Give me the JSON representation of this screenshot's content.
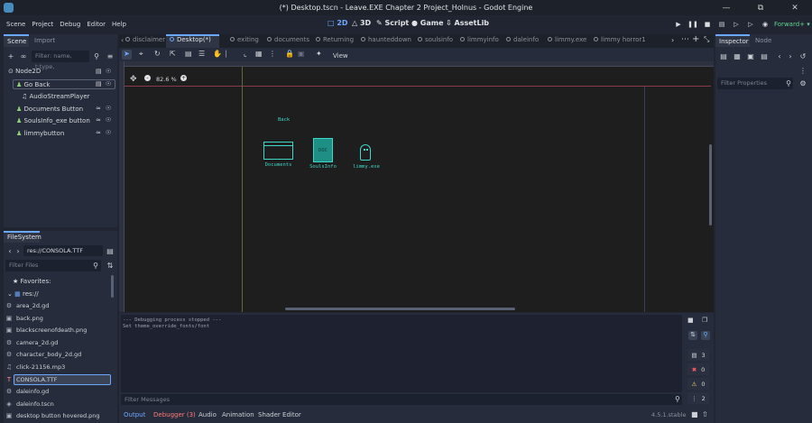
{
  "window": {
    "title": "(*) Desktop.tscn - Leave.EXE Chapter 2 Project_Holnus - Godot Engine"
  },
  "menu": [
    "Scene",
    "Project",
    "Debug",
    "Editor",
    "Help"
  ],
  "workspaces": [
    "2D",
    "3D",
    "Script",
    "Game",
    "AssetLib"
  ],
  "renderer": "Forward+",
  "scene_dock": {
    "tabs": [
      "Scene",
      "Import"
    ],
    "filter_placeholder": "Filter: name, t:type,",
    "nodes": [
      {
        "name": "Node2D"
      },
      {
        "name": "Go Back"
      },
      {
        "name": "AudioStreamPlayer"
      },
      {
        "name": "Documents Button"
      },
      {
        "name": "SoulsInfo_exe button"
      },
      {
        "name": "limmybutton"
      }
    ]
  },
  "filesystem": {
    "tab": "FileSystem",
    "path": "res://CONSOLA.TTF",
    "filter_placeholder": "Filter Files",
    "favorites": "Favorites:",
    "root": "res://",
    "files": [
      {
        "name": "area_2d.gd",
        "icon": "gear-icon"
      },
      {
        "name": "back.png",
        "icon": "image-icon"
      },
      {
        "name": "blackscreenofdeath.png",
        "icon": "image-icon"
      },
      {
        "name": "camera_2d.gd",
        "icon": "gear-icon"
      },
      {
        "name": "character_body_2d.gd",
        "icon": "gear-icon"
      },
      {
        "name": "click-21156.mp3",
        "icon": "audio-icon"
      },
      {
        "name": "CONSOLA.TTF",
        "icon": "font-icon"
      },
      {
        "name": "daleinfo.gd",
        "icon": "gear-icon"
      },
      {
        "name": "daleinfo.tscn",
        "icon": "scene-icon"
      },
      {
        "name": "desktop button hovered.png",
        "icon": "image-icon"
      }
    ]
  },
  "editor_tabs": [
    "disclaimer",
    "Desktop(*)",
    "exiting",
    "documents",
    "Returning",
    "haunteddown",
    "soulsinfo",
    "limmyinfo",
    "daleinfo",
    "limmy.exe",
    "limmy horror1"
  ],
  "viewport": {
    "zoom": "82.6 %",
    "view_label": "View",
    "items": {
      "back": "Back",
      "documents": "Documents",
      "soulsinfo": "SoulsInfo",
      "limmy": "limmy.exe",
      "folder_text": "DOC"
    }
  },
  "output": {
    "lines": [
      "--- Debugging process stopped ---",
      "Set theme_override_fonts/font"
    ],
    "filter_placeholder": "Filter Messages",
    "counts": {
      "messages": "3",
      "errors": "0",
      "warnings": "0",
      "info": "2"
    }
  },
  "bottom_tabs": {
    "output": "Output",
    "debugger": "Debugger (3)",
    "audio": "Audio",
    "animation": "Animation",
    "shader": "Shader Editor"
  },
  "version": "4.5.1.stable",
  "inspector": {
    "tabs": [
      "Inspector",
      "Node"
    ],
    "filter_placeholder": "Filter Properties"
  },
  "colors": {
    "accent": "#6da8ff",
    "teal": "#3fd7c7",
    "bg": "#202531",
    "panel": "#262c3b",
    "viewport": "#1e1e1e"
  }
}
